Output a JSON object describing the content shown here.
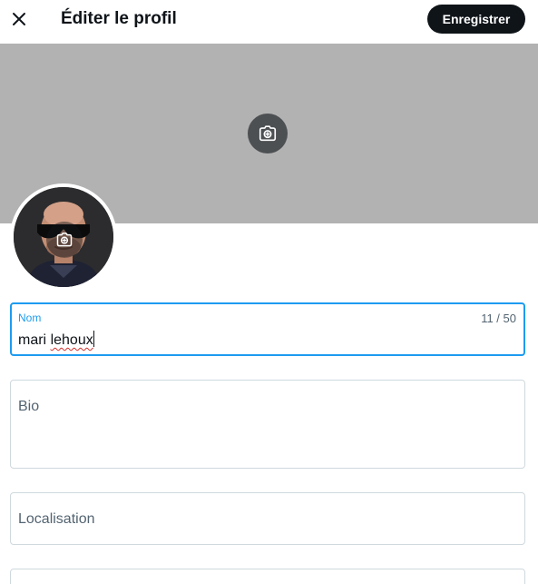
{
  "header": {
    "title": "Éditer le profil",
    "save_label": "Enregistrer"
  },
  "form": {
    "name": {
      "label": "Nom",
      "value_first": "mari",
      "value_second": "lehoux",
      "counter": "11 / 50"
    },
    "bio": {
      "label": "Bio"
    },
    "location": {
      "label": "Localisation"
    }
  },
  "colors": {
    "accent": "#1d9bf0",
    "primary_button": "#0f1419",
    "banner": "#b2b2b2",
    "border": "#cfd9de"
  },
  "icons": {
    "close": "close-icon",
    "banner_camera": "add-photo-camera-icon",
    "avatar_camera": "add-photo-camera-icon"
  }
}
